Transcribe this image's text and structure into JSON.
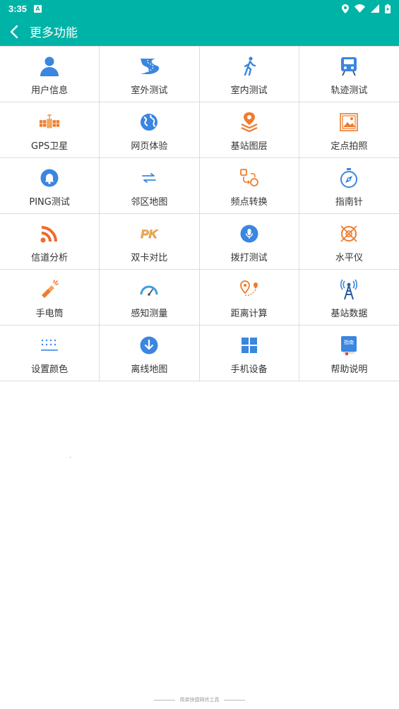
{
  "status_bar": {
    "time": "3:35",
    "sim_badge": "A"
  },
  "header": {
    "title": "更多功能"
  },
  "colors": {
    "primary": "#00b3a7",
    "blue": "#3a86e0",
    "orange": "#ef7b2c"
  },
  "features": [
    {
      "label": "用户信息",
      "icon": "user-icon"
    },
    {
      "label": "室外测试",
      "icon": "road-icon"
    },
    {
      "label": "室内测试",
      "icon": "walking-person-icon"
    },
    {
      "label": "轨迹测试",
      "icon": "train-icon"
    },
    {
      "label": "GPS卫星",
      "icon": "satellite-icon"
    },
    {
      "label": "网页体验",
      "icon": "globe-icon"
    },
    {
      "label": "基站图层",
      "icon": "map-layers-icon"
    },
    {
      "label": "定点拍照",
      "icon": "photo-icon"
    },
    {
      "label": "PING测试",
      "icon": "bell-icon"
    },
    {
      "label": "邻区地图",
      "icon": "swap-arrows-icon"
    },
    {
      "label": "频点转换",
      "icon": "convert-icon"
    },
    {
      "label": "指南针",
      "icon": "compass-icon"
    },
    {
      "label": "信道分析",
      "icon": "rss-icon"
    },
    {
      "label": "双卡对比",
      "icon": "pk-icon"
    },
    {
      "label": "拨打测试",
      "icon": "microphone-icon"
    },
    {
      "label": "水平仪",
      "icon": "level-icon"
    },
    {
      "label": "手电筒",
      "icon": "flashlight-icon"
    },
    {
      "label": "感知测量",
      "icon": "speedometer-icon"
    },
    {
      "label": "距离计算",
      "icon": "distance-icon"
    },
    {
      "label": "基站数据",
      "icon": "antenna-tower-icon"
    },
    {
      "label": "设置颜色",
      "icon": "dots-grid-icon"
    },
    {
      "label": "离线地图",
      "icon": "download-icon"
    },
    {
      "label": "手机设备",
      "icon": "windows-grid-icon"
    },
    {
      "label": "帮助说明",
      "icon": "guide-book-icon"
    }
  ],
  "guide_badge": "指南",
  "pk_text": "PK",
  "footer": {
    "text": "简单快捷网优工具"
  }
}
